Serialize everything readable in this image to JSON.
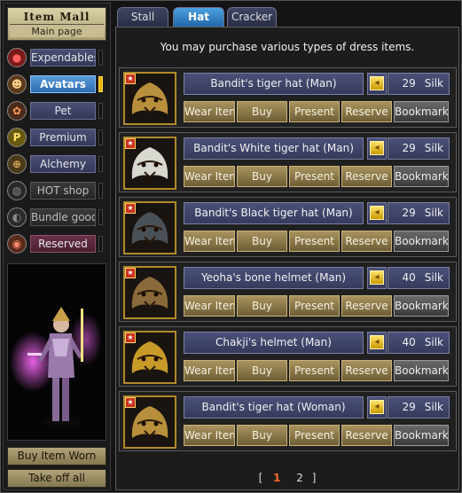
{
  "header": {
    "title": "Item Mall",
    "subtitle": "Main page"
  },
  "sidebar": {
    "categories": [
      {
        "label": "Expendables",
        "icon": "potion-icon",
        "style": "normal",
        "indicator": false
      },
      {
        "label": "Avatars",
        "icon": "avatar-icon",
        "style": "active",
        "indicator": true
      },
      {
        "label": "Pet",
        "icon": "pet-icon",
        "style": "normal",
        "indicator": false
      },
      {
        "label": "Premium",
        "icon": "premium-icon",
        "style": "normal",
        "indicator": false
      },
      {
        "label": "Alchemy",
        "icon": "alchemy-icon",
        "style": "normal",
        "indicator": false
      },
      {
        "label": "HOT shop",
        "icon": "hot-icon",
        "style": "dim",
        "indicator": false
      },
      {
        "label": "Bundle goods",
        "icon": "bundle-icon",
        "style": "dim",
        "indicator": false
      },
      {
        "label": "Reserved",
        "icon": "reserved-icon",
        "style": "red",
        "indicator": false
      }
    ],
    "buy_item_worn": "Buy Item Worn",
    "take_off_all": "Take off all"
  },
  "tabs": [
    {
      "label": "Stall",
      "active": false
    },
    {
      "label": "Hat",
      "active": true
    },
    {
      "label": "Cracker",
      "active": false
    }
  ],
  "notice": "You may purchase various types of dress items.",
  "actions": {
    "wear": "Wear Item",
    "buy": "Buy",
    "present": "Present",
    "reserve": "Reserve",
    "bookmark": "Bookmark"
  },
  "items": [
    {
      "name": "Bandit's tiger hat (Man)",
      "price": "29",
      "currency": "Silk",
      "thumb": "tiger-hat",
      "color": "#b8903c"
    },
    {
      "name": "Bandit's White tiger hat (Man)",
      "price": "29",
      "currency": "Silk",
      "thumb": "white-tiger-hat",
      "color": "#d8d8d0"
    },
    {
      "name": "Bandit's Black tiger hat (Man)",
      "price": "29",
      "currency": "Silk",
      "thumb": "black-tiger-hat",
      "color": "#4a5058"
    },
    {
      "name": "Yeoha's bone helmet (Man)",
      "price": "40",
      "currency": "Silk",
      "thumb": "bone-helmet",
      "color": "#8a6a3a"
    },
    {
      "name": "Chakji's helmet (Man)",
      "price": "40",
      "currency": "Silk",
      "thumb": "chakji-helmet",
      "color": "#c89a28"
    },
    {
      "name": "Bandit's tiger hat (Woman)",
      "price": "29",
      "currency": "Silk",
      "thumb": "tiger-hat-woman",
      "color": "#b8903c"
    }
  ],
  "pager": {
    "current": "1",
    "next": "2",
    "open": "[",
    "close": "]"
  },
  "colors": {
    "accent_tab": "#2f80c8",
    "gold_button": "#8a7744",
    "price_bar": "#3e4468",
    "pager_current": "#ff6a2a"
  }
}
